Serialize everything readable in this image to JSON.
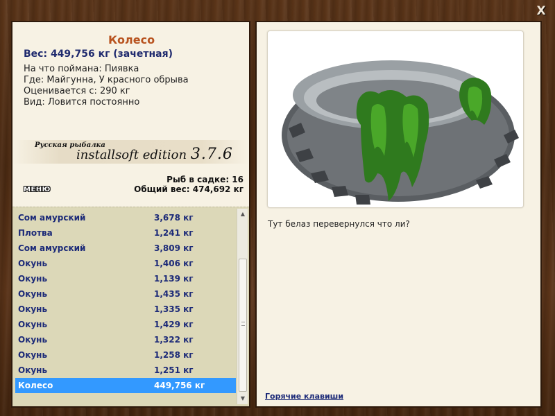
{
  "close_label": "X",
  "catch": {
    "name": "Колесо",
    "weight_line": "Вес: 449,756 кг (зачетная)",
    "bait_line": "На что поймана: Пиявка",
    "place_line": "Где: Майгунна, У красного обрыва",
    "value_line": "Оценивается с: 290 кг",
    "type_line": "Вид: Ловится постоянно",
    "description": "Тут белаз перевернулся что ли?",
    "image_icon": "tire-with-seaweed"
  },
  "banner": {
    "small": "Русская рыбалка",
    "big": "installsoft edition",
    "version": "3.7.6"
  },
  "stats": {
    "fish_in_keepnet": "Рыб в садке: 16",
    "total_weight": "Общий вес: 474,692 кг"
  },
  "menu_label": "МЕНЮ",
  "catch_list": [
    {
      "name": "Сом амурский",
      "weight": "3,678 кг"
    },
    {
      "name": "Плотва",
      "weight": "1,241 кг"
    },
    {
      "name": "Сом амурский",
      "weight": "3,809 кг"
    },
    {
      "name": "Окунь",
      "weight": "1,406 кг"
    },
    {
      "name": "Окунь",
      "weight": "1,139 кг"
    },
    {
      "name": "Окунь",
      "weight": "1,435 кг"
    },
    {
      "name": "Окунь",
      "weight": "1,335 кг"
    },
    {
      "name": "Окунь",
      "weight": "1,429 кг"
    },
    {
      "name": "Окунь",
      "weight": "1,322 кг"
    },
    {
      "name": "Окунь",
      "weight": "1,258 кг"
    },
    {
      "name": "Окунь",
      "weight": "1,251 кг"
    },
    {
      "name": "Колесо",
      "weight": "449,756 кг"
    }
  ],
  "hotkeys_label": "Горячие клавиши",
  "colors": {
    "title": "#b8531f",
    "accent_text": "#1c2a78",
    "selected_row": "#3399ff",
    "panel_bg": "#f7f2e4",
    "list_bg": "#dcd8b8"
  }
}
